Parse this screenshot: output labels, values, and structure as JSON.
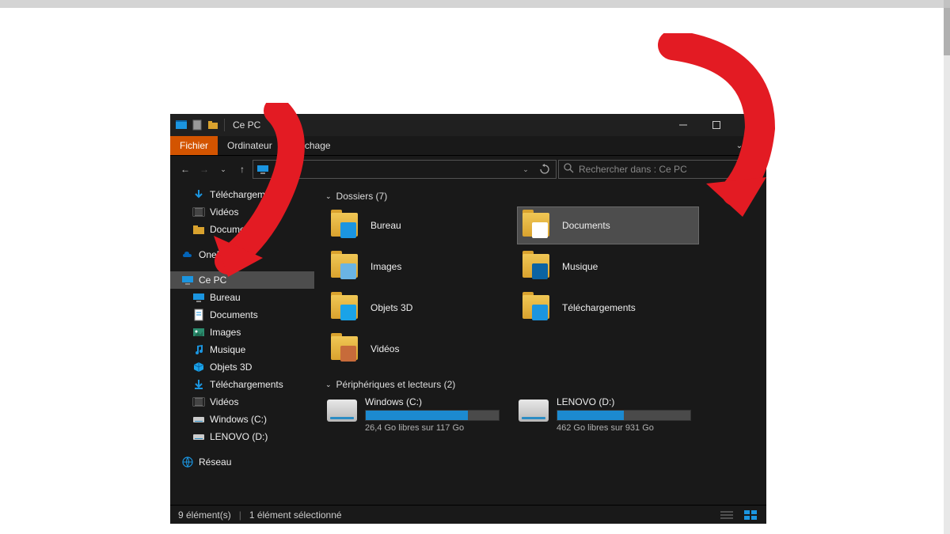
{
  "titlebar": {
    "title": "Ce PC"
  },
  "ribbon": {
    "file": "Fichier",
    "tabs": [
      "Ordinateur",
      "Affichage"
    ]
  },
  "search": {
    "placeholder": "Rechercher dans : Ce PC"
  },
  "sidebar": {
    "quick": [
      {
        "label": "Téléchargements",
        "icon": "download"
      },
      {
        "label": "Vidéos",
        "icon": "video"
      },
      {
        "label": "Documents",
        "icon": "folder"
      }
    ],
    "onedrive": "OneDrive",
    "thispc": "Ce PC",
    "thispc_items": [
      {
        "label": "Bureau",
        "icon": "desktop"
      },
      {
        "label": "Documents",
        "icon": "document"
      },
      {
        "label": "Images",
        "icon": "image"
      },
      {
        "label": "Musique",
        "icon": "music"
      },
      {
        "label": "Objets 3D",
        "icon": "3d"
      },
      {
        "label": "Téléchargements",
        "icon": "download"
      },
      {
        "label": "Vidéos",
        "icon": "video"
      },
      {
        "label": "Windows (C:)",
        "icon": "drive"
      },
      {
        "label": "LENOVO (D:)",
        "icon": "drive"
      }
    ],
    "network": "Réseau"
  },
  "content": {
    "folders_header": "Dossiers (7)",
    "folders": [
      {
        "label": "Bureau",
        "overlay": "#1b95e0"
      },
      {
        "label": "Documents",
        "overlay": "#ffffff"
      },
      {
        "label": "Images",
        "overlay": "#6ab4e4"
      },
      {
        "label": "Musique",
        "overlay": "#0b63a3"
      },
      {
        "label": "Objets 3D",
        "overlay": "#1aa3e8"
      },
      {
        "label": "Téléchargements",
        "overlay": "#1b95e0"
      },
      {
        "label": "Vidéos",
        "overlay": "#c76b3a"
      }
    ],
    "selected_folder_index": 1,
    "drives_header": "Périphériques et lecteurs (2)",
    "drives": [
      {
        "name": "Windows (C:)",
        "free_text": "26,4 Go libres sur 117 Go",
        "fill_pct": 77
      },
      {
        "name": "LENOVO (D:)",
        "free_text": "462 Go libres sur 931 Go",
        "fill_pct": 50
      }
    ]
  },
  "statusbar": {
    "count": "9 élément(s)",
    "selection": "1 élément sélectionné"
  }
}
